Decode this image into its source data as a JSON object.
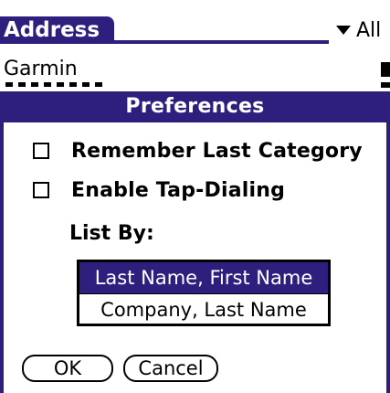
{
  "colors": {
    "accent": "#2e1f7e",
    "background": "#ffffff",
    "text": "#000000"
  },
  "app": {
    "title": "Address",
    "category": "All",
    "category_icon": "triangle-down-icon",
    "records": [
      {
        "name": "Garmin",
        "flag_icon": "note-flag-icon"
      }
    ]
  },
  "dialog": {
    "title": "Preferences",
    "options": [
      {
        "label": "Remember Last Category",
        "checked": false
      },
      {
        "label": "Enable Tap-Dialing",
        "checked": false
      }
    ],
    "list_by_label": "List By:",
    "sort_options": [
      {
        "label": "Last Name, First Name",
        "selected": true
      },
      {
        "label": "Company, Last Name",
        "selected": false
      }
    ],
    "buttons": {
      "ok": "OK",
      "cancel": "Cancel"
    }
  }
}
